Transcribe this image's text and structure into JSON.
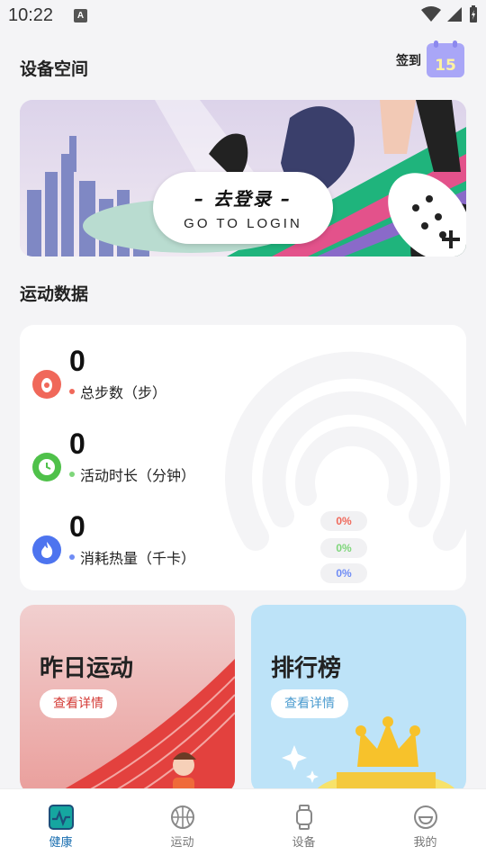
{
  "status_bar": {
    "time": "10:22",
    "notification_icon_letter": "A"
  },
  "header": {
    "title": "设备空间",
    "signin_label": "签到",
    "signin_day": "15"
  },
  "banner": {
    "title_cn": "– 去登录 –",
    "title_en": "GO TO LOGIN"
  },
  "sport_section": {
    "title": "运动数据"
  },
  "metrics": [
    {
      "value": "0",
      "label": "总步数（步）",
      "color": "#f0685a",
      "icon": "footprint-icon"
    },
    {
      "value": "0",
      "label": "活动时长（分钟）",
      "color": "#7ed67a",
      "icon": "clock-icon"
    },
    {
      "value": "0",
      "label": "消耗热量（千卡）",
      "color": "#6f8cf5",
      "icon": "flame-icon"
    }
  ],
  "percentages": [
    {
      "text": "0%",
      "color": "#f0685a"
    },
    {
      "text": "0%",
      "color": "#7ed67a"
    },
    {
      "text": "0%",
      "color": "#6f8cf5"
    }
  ],
  "tiles": [
    {
      "title": "昨日运动",
      "button": "查看详情"
    },
    {
      "title": "排行榜",
      "button": "查看详情"
    }
  ],
  "tabbar": [
    {
      "label": "健康",
      "active": true
    },
    {
      "label": "运动",
      "active": false
    },
    {
      "label": "设备",
      "active": false
    },
    {
      "label": "我的",
      "active": false
    }
  ]
}
